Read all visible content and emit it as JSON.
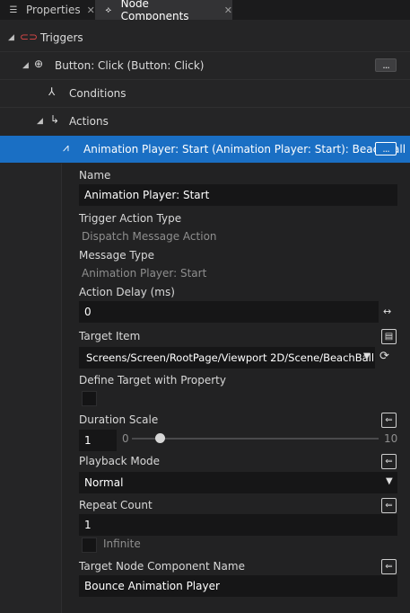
{
  "tabs": [
    {
      "label": "Properties",
      "icon": "list-icon",
      "active": false
    },
    {
      "label": "Node Components",
      "icon": "node-components-icon",
      "active": true
    }
  ],
  "tree": {
    "triggers": {
      "label": "Triggers",
      "icon": "trigger-icon"
    },
    "button_click": {
      "label": "Button: Click (Button: Click)",
      "icon": "click-icon",
      "menu": "..."
    },
    "conditions": {
      "label": "Conditions",
      "icon": "conditions-icon"
    },
    "actions": {
      "label": "Actions",
      "icon": "actions-icon"
    },
    "animation_action": {
      "label": "Animation Player: Start (Animation Player: Start): BeachBall",
      "icon": "animation-player-icon",
      "menu": "..."
    }
  },
  "properties": {
    "name": {
      "label": "Name",
      "value": "Animation Player: Start"
    },
    "trigger_action_type": {
      "label": "Trigger Action Type",
      "value": "Dispatch Message Action"
    },
    "message_type": {
      "label": "Message Type",
      "value": "Animation Player: Start"
    },
    "action_delay": {
      "label": "Action Delay (ms)",
      "value": "0"
    },
    "target_item": {
      "label": "Target Item",
      "value": "Screens/Screen/RootPage/Viewport 2D/Scene/BeachBall"
    },
    "define_target": {
      "label": "Define Target with Property",
      "checked": false
    },
    "duration_scale": {
      "label": "Duration Scale",
      "value": "1",
      "min_label": "0",
      "max_label": "10",
      "slider_value": 1,
      "slider_min": 0,
      "slider_max": 10
    },
    "playback_mode": {
      "label": "Playback Mode",
      "value": "Normal"
    },
    "repeat_count": {
      "label": "Repeat Count",
      "value": "1",
      "infinite_label": "Infinite",
      "infinite_checked": false
    },
    "target_component": {
      "label": "Target Node Component Name",
      "value": "Bounce Animation Player"
    }
  },
  "colors": {
    "selection": "#1a6fc4",
    "background": "#252526",
    "field": "#161617"
  }
}
